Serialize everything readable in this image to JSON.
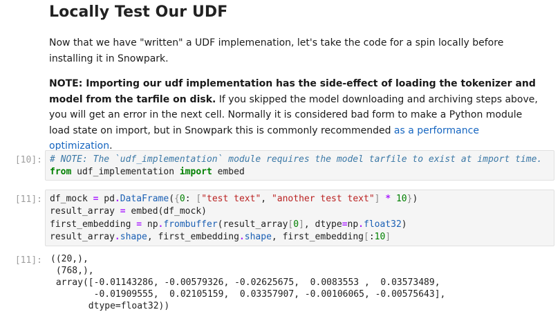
{
  "markdown": {
    "title": "Locally Test Our UDF",
    "para1": "Now that we have \"written\" a UDF implemenation, let's take the code for a spin locally before installing it in Snowpark.",
    "para2_bold": "NOTE: Importing our udf implementation has the side-effect of loading the tokenizer and model from the tarfile on disk.",
    "para2_text": " If you skipped the model downloading and archiving steps above, you will get an error in the next cell. Normally it is considered bad form to make a Python module load state on import, but in Snowpark this is commonly recommended ",
    "para2_link": "as a performance optimization",
    "para2_end": "."
  },
  "cells": [
    {
      "prompt": "[10]:",
      "lines": [
        "# NOTE: The `udf_implementation` module requires the model tarfile to exist at import time.",
        "from udf_implementation import embed"
      ]
    },
    {
      "prompt": "[11]:",
      "lines": [
        "df_mock = pd.DataFrame({0: [\"test text\", \"another test text\"] * 10})",
        "result_array = embed(df_mock)",
        "first_embedding = np.frombuffer(result_array[0], dtype=np.float32)",
        "result_array.shape, first_embedding.shape, first_embedding[:10]"
      ]
    }
  ],
  "output": {
    "prompt": "[11]:",
    "text": "((20,),\n (768,),\n array([-0.01143286, -0.00579326, -0.02625675,  0.0083553 ,  0.03573489,\n        -0.01909555,  0.02105159,  0.03357907, -0.00106065, -0.00575643],\n       dtype=float32))"
  }
}
